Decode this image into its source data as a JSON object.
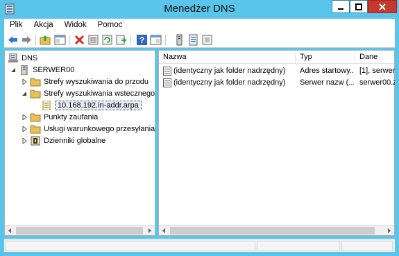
{
  "window": {
    "title": "Menedżer DNS"
  },
  "menu": [
    "Plik",
    "Akcja",
    "Widok",
    "Pomoc"
  ],
  "toolbar": {
    "icons": [
      "back-arrow-icon",
      "forward-arrow-icon",
      "up-folder-icon",
      "show-hide-tree-icon",
      "delete-icon",
      "properties-icon",
      "refresh-icon",
      "export-list-icon",
      "help-icon",
      "console-icon",
      "server-icon",
      "zone-list-icon",
      "record-icon"
    ]
  },
  "tree": {
    "root": "DNS",
    "server": "SERWER00",
    "items": [
      {
        "label": "Strefy wyszukiwania do przodu",
        "expanded": false
      },
      {
        "label": "Strefy wyszukiwania wstecznego",
        "expanded": true
      },
      {
        "label": "10.168.192.in-addr.arpa",
        "selected": true
      },
      {
        "label": "Punkty zaufania",
        "expanded": false
      },
      {
        "label": "Usługi warunkowego przesyłania",
        "expanded": false
      },
      {
        "label": "Dzienniki globalne",
        "expanded": false
      }
    ]
  },
  "list": {
    "columns": [
      "Nazwa",
      "Typ",
      "Dane"
    ],
    "rows": [
      {
        "name": "(identyczny jak folder nadrzędny)",
        "type": "Adres startowy...",
        "data": "[1], serwer"
      },
      {
        "name": "(identyczny jak folder nadrzędny)",
        "type": "Serwer nazw (...",
        "data": "serwer00.z"
      }
    ]
  },
  "colors": {
    "titlebar": "#5ac5ea",
    "close_button": "#c7392c",
    "folder": "#e8c15a"
  }
}
